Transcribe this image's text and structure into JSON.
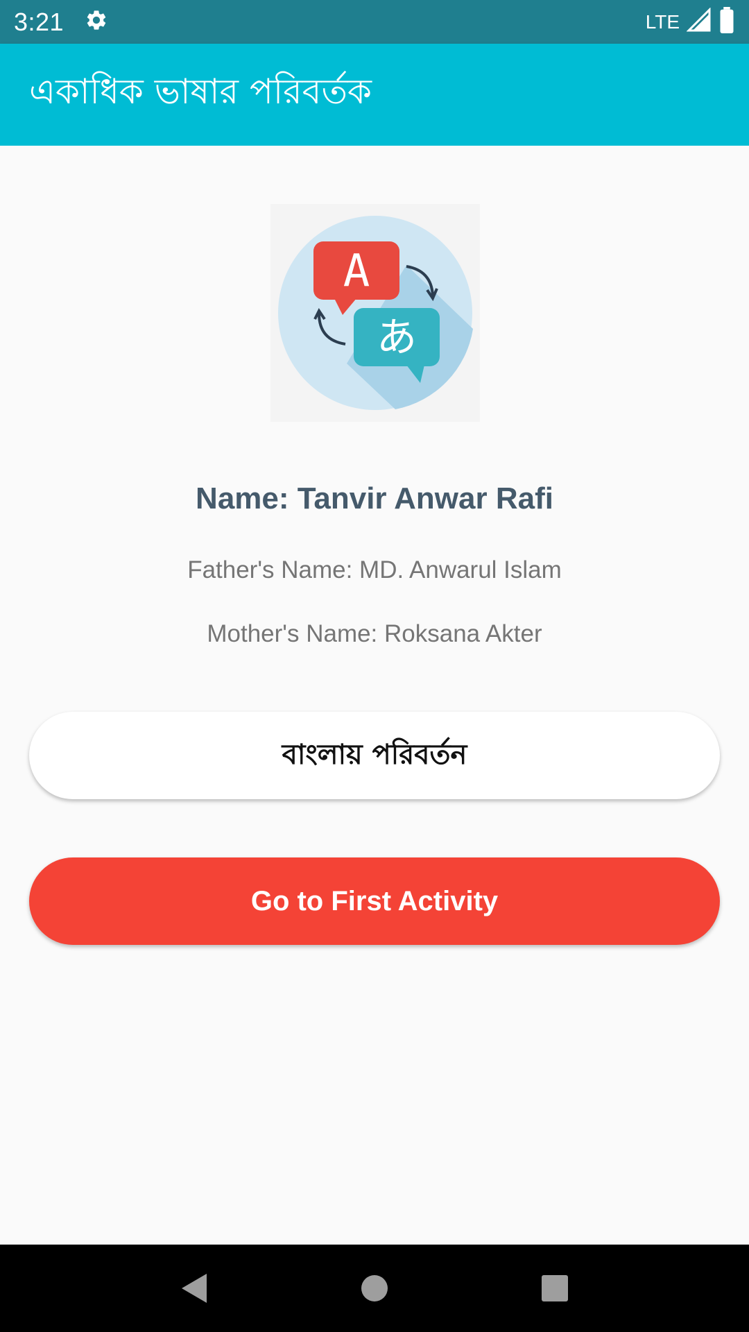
{
  "status_bar": {
    "time": "3:21",
    "network": "LTE",
    "icons": [
      "settings-icon",
      "signal-icon",
      "battery-icon"
    ]
  },
  "app_bar": {
    "title": "একাধিক ভাষার পরিবর্তক"
  },
  "profile": {
    "logo_icon": "translate-icon",
    "logo_glyph_a": "A",
    "logo_glyph_jp": "あ",
    "name": "Name: Tanvir Anwar Rafi",
    "father": "Father's Name: MD. Anwarul Islam",
    "mother": "Mother's Name: Roksana Akter"
  },
  "buttons": {
    "change_language": "বাংলায় পরিবর্তন",
    "go_first": "Go to First Activity"
  },
  "colors": {
    "status_bar": "#1f7f8f",
    "app_bar": "#00bcd4",
    "primary_button": "#f44336",
    "name_text": "#455a6b"
  },
  "nav_bar": {
    "icons": [
      "back-icon",
      "home-icon",
      "recents-icon"
    ]
  }
}
